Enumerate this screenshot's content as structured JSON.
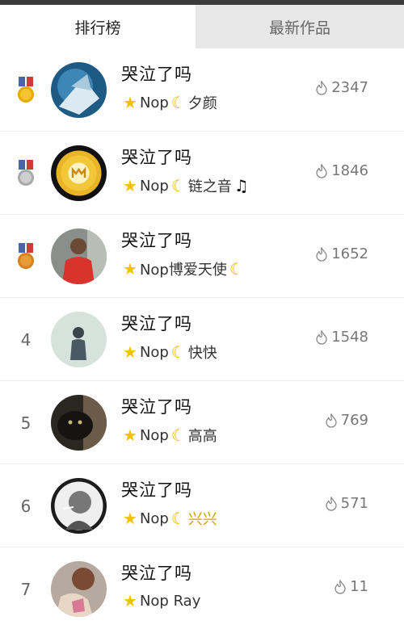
{
  "tabs": [
    {
      "label": "排行榜",
      "active": true
    },
    {
      "label": "最新作品",
      "active": false
    }
  ],
  "rows": [
    {
      "rank": "1",
      "medal": true,
      "title": "哭泣了吗",
      "author": "Nop",
      "suffix": "夕颜",
      "count": "2347"
    },
    {
      "rank": "2",
      "medal": true,
      "title": "哭泣了吗",
      "author": "Nop",
      "suffix": "链之音",
      "count": "1846"
    },
    {
      "rank": "3",
      "medal": true,
      "title": "哭泣了吗",
      "author": "Nop博爱天使",
      "suffix": "",
      "count": "1652"
    },
    {
      "rank": "4",
      "medal": false,
      "title": "哭泣了吗",
      "author": "Nop",
      "suffix": "快快",
      "count": "1548"
    },
    {
      "rank": "5",
      "medal": false,
      "title": "哭泣了吗",
      "author": "Nop",
      "suffix": "高高",
      "count": "769"
    },
    {
      "rank": "6",
      "medal": false,
      "title": "哭泣了吗",
      "author": "Nop",
      "suffix": "兴兴",
      "count": "571"
    },
    {
      "rank": "7",
      "medal": false,
      "title": "哭泣了吗",
      "author": "Nop Ray",
      "suffix": "",
      "count": "11"
    }
  ],
  "icons": {
    "star": "star-icon",
    "moon": "crescent-moon-icon",
    "play_count": "flame-icon"
  },
  "colors": {
    "gold": "#e8a900",
    "silver": "#b8b8b8",
    "bronze": "#d8801a",
    "ribbon_blue": "#4a64a8",
    "ribbon_red": "#c8403a"
  }
}
